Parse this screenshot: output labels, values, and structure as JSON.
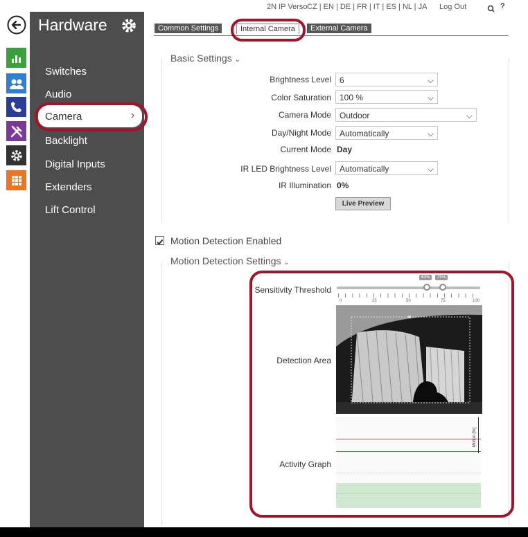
{
  "colors": {
    "accent_ring": "#a5122a",
    "sidebar_bg": "#4d4d4d",
    "tab_dark": "#555555"
  },
  "rail": {
    "icons": [
      "back-arrow-icon",
      "status-chart-icon",
      "directory-users-icon",
      "calls-phone-icon",
      "services-tools-icon",
      "hardware-gear-icon",
      "system-grid-icon"
    ]
  },
  "sidebar": {
    "title": "Hardware",
    "items": [
      {
        "label": "Switches"
      },
      {
        "label": "Audio"
      },
      {
        "label": "Camera",
        "chevron": "›"
      },
      {
        "label": "Backlight"
      },
      {
        "label": "Digital Inputs"
      },
      {
        "label": "Extenders"
      },
      {
        "label": "Lift Control"
      }
    ]
  },
  "topbar": {
    "device": "2N IP Verso",
    "languages": "CZ | EN | DE | FR | IT | ES | NL | JA",
    "logout": "Log Out",
    "help": "?"
  },
  "tabs": [
    {
      "label": "Common Settings"
    },
    {
      "label": "Internal Camera"
    },
    {
      "label": "External Camera"
    }
  ],
  "basic": {
    "title": "Basic Settings",
    "brightness_label": "Brightness Level",
    "brightness_value": "6",
    "saturation_label": "Color Saturation",
    "saturation_value": "100 %",
    "mode_label": "Camera Mode",
    "mode_value": "Outdoor",
    "daynight_label": "Day/Night Mode",
    "daynight_value": "Automatically",
    "current_label": "Current Mode",
    "current_value": "Day",
    "irled_label": "IR LED Brightness Level",
    "irled_value": "Automatically",
    "irillum_label": "IR Illumination",
    "irillum_value": "0%",
    "preview_button": "Live Preview"
  },
  "motion": {
    "enabled_label": "Motion Detection Enabled",
    "enabled": true,
    "settings_title": "Motion Detection Settings",
    "sensitivity_label": "Sensitivity Threshold",
    "sensitivity_low": "63%",
    "sensitivity_high": "75%",
    "scale_ticks": [
      "0",
      "25",
      "50",
      "75",
      "100"
    ],
    "area_label": "Detection Area",
    "graph_label": "Activity Graph",
    "graph_axis_label": "Motion [%]"
  }
}
